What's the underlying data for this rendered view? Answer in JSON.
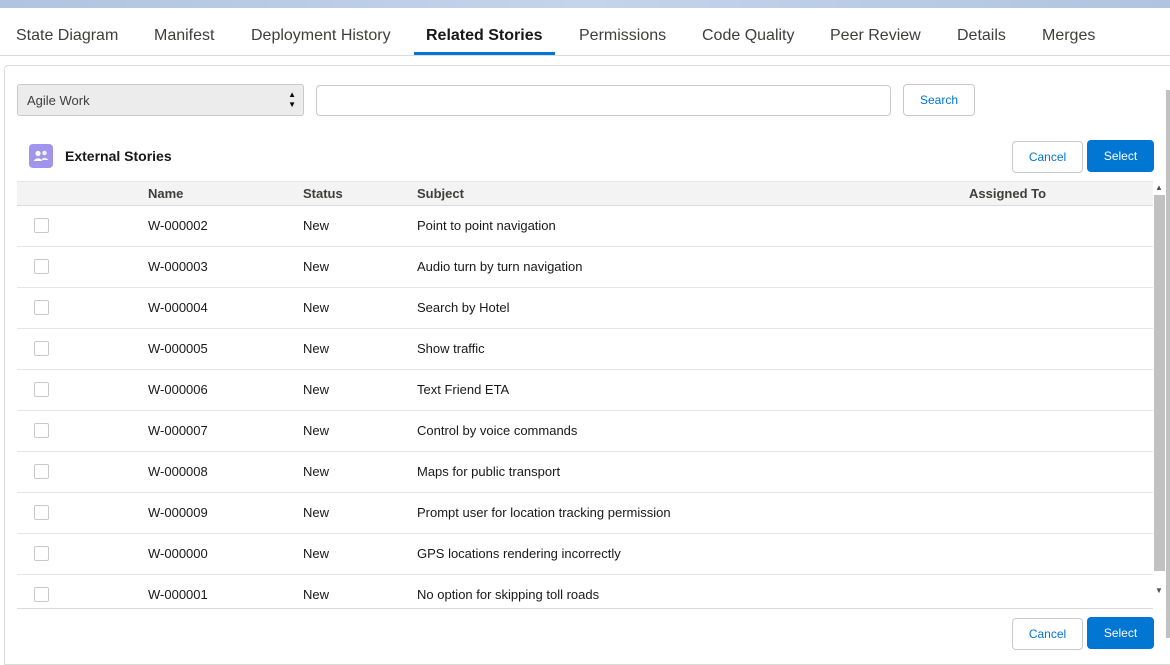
{
  "tabs": [
    {
      "label": "State Diagram",
      "active": false
    },
    {
      "label": "Manifest",
      "active": false
    },
    {
      "label": "Deployment History",
      "active": false
    },
    {
      "label": "Related Stories",
      "active": true
    },
    {
      "label": "Permissions",
      "active": false
    },
    {
      "label": "Code Quality",
      "active": false
    },
    {
      "label": "Peer Review",
      "active": false
    },
    {
      "label": "Details",
      "active": false
    },
    {
      "label": "Merges",
      "active": false
    }
  ],
  "filter": {
    "selected_value": "Agile Work",
    "search_value": "",
    "search_button": "Search"
  },
  "card": {
    "title": "External Stories",
    "icon": "user-group-icon",
    "cancel_label": "Cancel",
    "select_label": "Select"
  },
  "table": {
    "columns": [
      "Name",
      "Status",
      "Subject",
      "Assigned To"
    ],
    "rows": [
      {
        "name": "W-000002",
        "status": "New",
        "subject": "Point to point navigation",
        "assigned_to": ""
      },
      {
        "name": "W-000003",
        "status": "New",
        "subject": "Audio turn by turn navigation",
        "assigned_to": ""
      },
      {
        "name": "W-000004",
        "status": "New",
        "subject": "Search by Hotel",
        "assigned_to": ""
      },
      {
        "name": "W-000005",
        "status": "New",
        "subject": "Show traffic",
        "assigned_to": ""
      },
      {
        "name": "W-000006",
        "status": "New",
        "subject": "Text Friend ETA",
        "assigned_to": ""
      },
      {
        "name": "W-000007",
        "status": "New",
        "subject": "Control by voice commands",
        "assigned_to": ""
      },
      {
        "name": "W-000008",
        "status": "New",
        "subject": "Maps for public transport",
        "assigned_to": ""
      },
      {
        "name": "W-000009",
        "status": "New",
        "subject": "Prompt user for location tracking permission",
        "assigned_to": ""
      },
      {
        "name": "W-000000",
        "status": "New",
        "subject": "GPS locations rendering incorrectly",
        "assigned_to": ""
      },
      {
        "name": "W-000001",
        "status": "New",
        "subject": "No option for skipping toll roads",
        "assigned_to": ""
      }
    ]
  },
  "footer": {
    "cancel_label": "Cancel",
    "select_label": "Select"
  },
  "colors": {
    "brand": "#0176d3",
    "icon_bg": "#a094ed"
  }
}
